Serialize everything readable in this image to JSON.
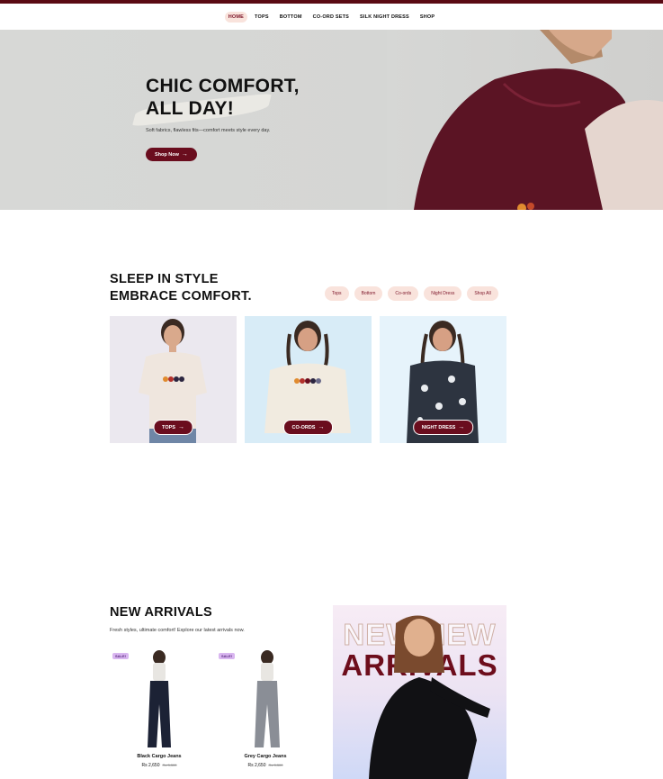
{
  "nav": {
    "items": [
      "HOME",
      "TOPS",
      "BOTTOM",
      "CO-ORD SETS",
      "SILK NIGHT DRESS",
      "SHOP"
    ]
  },
  "hero": {
    "title_line1": "CHIC COMFORT,",
    "title_line2": "ALL DAY!",
    "subtitle": "Soft fabrics, flawless fits—comfort meets style every day.",
    "button": "Shop Now"
  },
  "categories": {
    "heading_line1": "SLEEP IN STYLE",
    "heading_line2": "EMBRACE COMFORT.",
    "pills": [
      "Tops",
      "Bottom",
      "Co-ords",
      "Night Dress",
      "Shop All"
    ],
    "cards": [
      {
        "label": "TOPS",
        "icon": "arrow-right-icon"
      },
      {
        "label": "CO-ORDS",
        "icon": "arrow-right-icon"
      },
      {
        "label": "NIGHT DRESS",
        "icon": "arrow-right-icon"
      }
    ]
  },
  "new_arrivals": {
    "heading": "NEW ARRIVALS",
    "subtitle": "Fresh styles, ultimate comfort! Explore our latest arrivals now.",
    "products": [
      {
        "badge": "SALE!",
        "name": "Black Cargo Jeans",
        "price": "Rs 2,650",
        "old_price": "Rs 3,500"
      },
      {
        "badge": "SALE!",
        "name": "Grey Cargo Jeans",
        "price": "Rs 2,650",
        "old_price": "Rs 3,500"
      }
    ],
    "banner": {
      "line1": "NEW NEW",
      "line2": "ARRIVALS"
    }
  },
  "colors": {
    "brand": "#6a0d1e",
    "pill_bg": "#f9e3dc",
    "topbar": "#5a0a14"
  }
}
